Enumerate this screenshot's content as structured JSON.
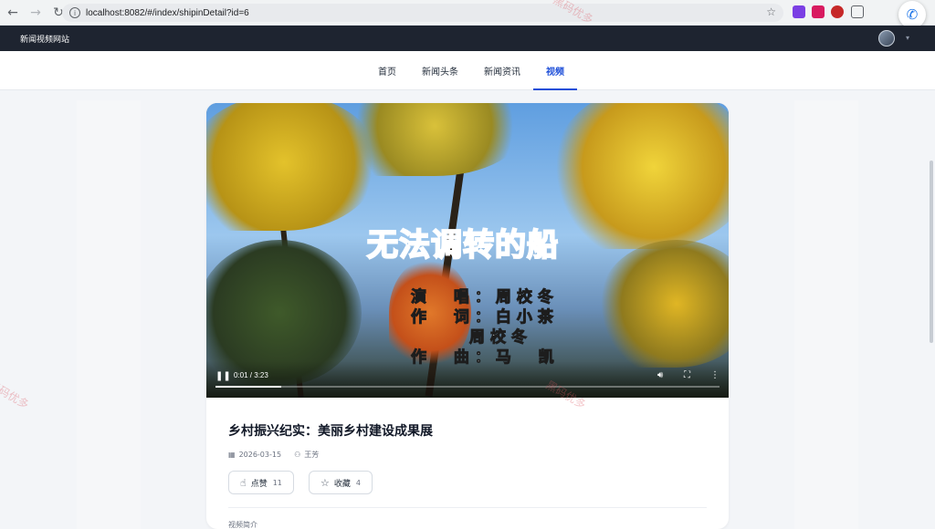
{
  "browser": {
    "url": "localhost:8082/#/index/shipinDetail?id=6"
  },
  "site": {
    "brand": "新闻视频网站"
  },
  "nav": {
    "tabs": [
      {
        "label": "首页"
      },
      {
        "label": "新闻头条"
      },
      {
        "label": "新闻资讯"
      },
      {
        "label": "视频"
      }
    ],
    "active_index": 3
  },
  "video": {
    "song_title": "无法调转的船",
    "credits": [
      {
        "role": "演  唱：",
        "name": "周校冬"
      },
      {
        "role": "作  词：",
        "name": "白小茶"
      },
      {
        "role": "",
        "name": "周校冬"
      },
      {
        "role": "作  曲：",
        "name": "马  凯"
      }
    ],
    "time": "0:01 / 3:23",
    "progress": 0.13
  },
  "article": {
    "title": "乡村振兴纪实：美丽乡村建设成果展",
    "date": "2026-03-15",
    "author": "王芳",
    "like_label": "点赞",
    "like_count": "11",
    "fav_label": "收藏",
    "fav_count": "4",
    "section_label": "视频简介"
  },
  "watermark": "黑码优多",
  "colors": {
    "accent": "#1d4ed8",
    "header_bg": "#1e2430"
  }
}
